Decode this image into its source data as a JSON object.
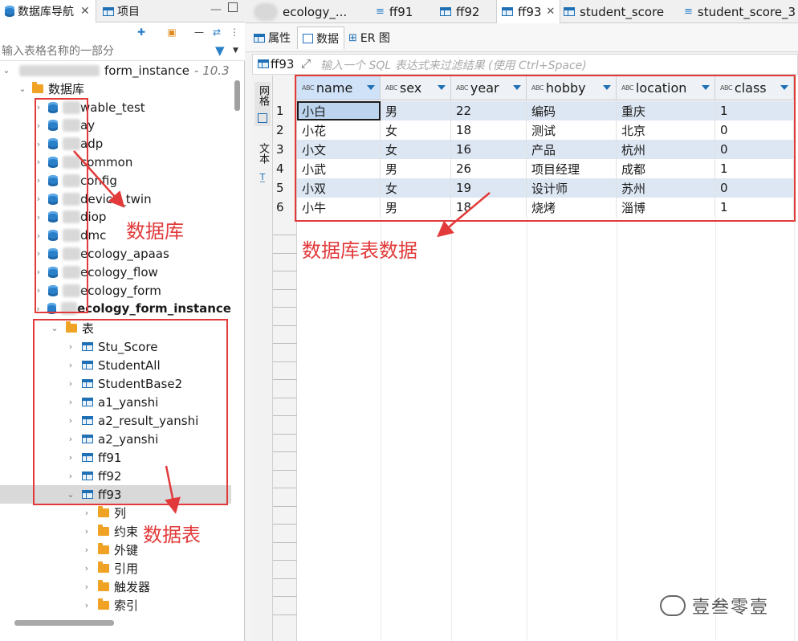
{
  "left_tabs": {
    "navigator": "数据库导航",
    "project": "项目"
  },
  "filter_placeholder": "输入表格名称的一部分",
  "connection": {
    "name": "form_instance",
    "version": "- 10.3"
  },
  "databases_folder": "数据库",
  "databases": [
    "wable_test",
    "ay",
    "adp",
    "common",
    "config",
    "device_twin",
    "diop",
    "dmc",
    "ecology_apaas",
    "ecology_flow",
    "ecology_form",
    "ecology_form_instance"
  ],
  "tables_folder": "表",
  "tables": [
    "Stu_Score",
    "StudentAll",
    "StudentBase2",
    "a1_yanshi",
    "a2_result_yanshi",
    "a2_yanshi",
    "ff91",
    "ff92",
    "ff93"
  ],
  "sub_folders": [
    "列",
    "约束",
    "外键",
    "引用",
    "触发器",
    "索引"
  ],
  "editor_tabs": [
    "ecology_...",
    "ff91",
    "ff92",
    "ff93",
    "student_score",
    "student_score_3"
  ],
  "sub_tabs": [
    "属性",
    "数据",
    "ER 图"
  ],
  "sql_filter": {
    "table_label": "ff93",
    "placeholder": "输入一个 SQL 表达式来过滤结果 (使用 Ctrl+Space)"
  },
  "side_strip": {
    "grid_label": "网格",
    "text_label": "文本"
  },
  "grid": {
    "columns": [
      "name",
      "sex",
      "year",
      "hobby",
      "location",
      "class"
    ],
    "rows": [
      [
        "小白",
        "男",
        "22",
        "编码",
        "重庆",
        "1"
      ],
      [
        "小花",
        "女",
        "18",
        "测试",
        "北京",
        "0"
      ],
      [
        "小文",
        "女",
        "16",
        "产品",
        "杭州",
        "0"
      ],
      [
        "小武",
        "男",
        "26",
        "项目经理",
        "成都",
        "1"
      ],
      [
        "小双",
        "女",
        "19",
        "设计师",
        "苏州",
        "0"
      ],
      [
        "小牛",
        "男",
        "18",
        "烧烤",
        "淄博",
        "1"
      ]
    ]
  },
  "annotations": {
    "database": "数据库",
    "table": "数据表",
    "table_data": "数据库表数据"
  },
  "watermark": "壹叁零壹",
  "colors": {
    "accent": "#1f6fb5",
    "annotation_red": "#e23a3a",
    "row_alt": "#dde7f3"
  }
}
